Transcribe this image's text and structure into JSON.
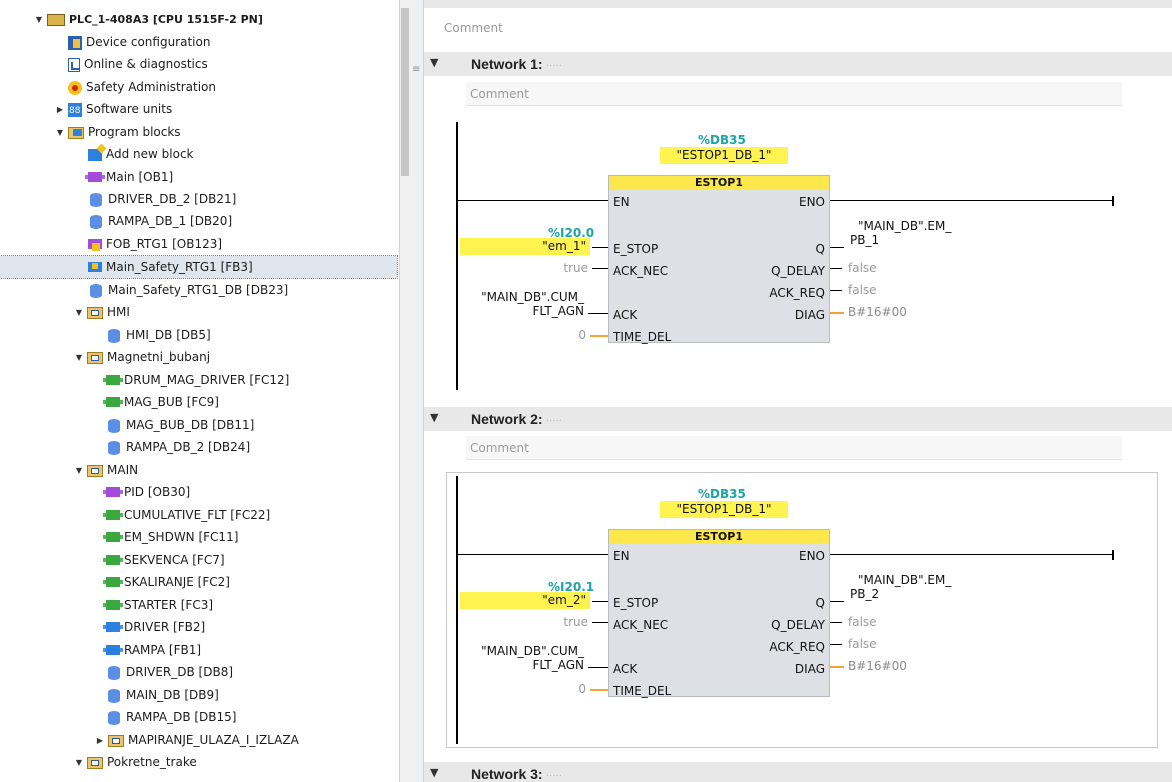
{
  "tree": {
    "items": [
      {
        "label": "PLC_1-408A3 [CPU 1515F-2 PN]",
        "icon": "plc-icon"
      },
      {
        "label": "Device configuration",
        "icon": "device-config-icon"
      },
      {
        "label": "Online & diagnostics",
        "icon": "online-diagnostics-icon"
      },
      {
        "label": "Safety Administration",
        "icon": "safety-admin-icon"
      },
      {
        "label": "Software units",
        "icon": "software-units-icon"
      },
      {
        "label": "Program blocks",
        "icon": "folder-icon"
      },
      {
        "label": "Add new block",
        "icon": "add-block-icon"
      },
      {
        "label": "Main [OB1]",
        "icon": "ob-icon"
      },
      {
        "label": "DRIVER_DB_2 [DB21]",
        "icon": "db-icon"
      },
      {
        "label": "RAMPA_DB_1 [DB20]",
        "icon": "db-icon"
      },
      {
        "label": "FOB_RTG1 [OB123]",
        "icon": "fob-icon"
      },
      {
        "label": "Main_Safety_RTG1 [FB3]",
        "icon": "safety-fb-icon"
      },
      {
        "label": "Main_Safety_RTG1_DB [DB23]",
        "icon": "db-icon"
      },
      {
        "label": "HMI",
        "icon": "group-folder-icon"
      },
      {
        "label": "HMI_DB [DB5]",
        "icon": "db-icon"
      },
      {
        "label": "Magnetni_bubanj",
        "icon": "group-folder-icon"
      },
      {
        "label": "DRUM_MAG_DRIVER [FC12]",
        "icon": "fc-icon"
      },
      {
        "label": "MAG_BUB [FC9]",
        "icon": "fc-icon"
      },
      {
        "label": "MAG_BUB_DB [DB11]",
        "icon": "db-icon"
      },
      {
        "label": "RAMPA_DB_2 [DB24]",
        "icon": "db-icon"
      },
      {
        "label": "MAIN",
        "icon": "group-folder-icon"
      },
      {
        "label": "PID [OB30]",
        "icon": "ob-icon"
      },
      {
        "label": "CUMULATIVE_FLT [FC22]",
        "icon": "fc-icon"
      },
      {
        "label": "EM_SHDWN [FC11]",
        "icon": "fc-icon"
      },
      {
        "label": "SEKVENCA [FC7]",
        "icon": "fc-icon"
      },
      {
        "label": "SKALIRANJE [FC2]",
        "icon": "fc-icon"
      },
      {
        "label": "STARTER [FC3]",
        "icon": "fc-icon"
      },
      {
        "label": "DRIVER [FB2]",
        "icon": "fb-icon"
      },
      {
        "label": "RAMPA [FB1]",
        "icon": "fb-icon"
      },
      {
        "label": "DRIVER_DB [DB8]",
        "icon": "db-icon"
      },
      {
        "label": "MAIN_DB [DB9]",
        "icon": "db-icon"
      },
      {
        "label": "RAMPA_DB [DB15]",
        "icon": "db-icon"
      },
      {
        "label": "MAPIRANJE_ULAZA_I_IZLAZA",
        "icon": "group-folder-icon"
      },
      {
        "label": "Pokretne_trake",
        "icon": "group-folder-icon"
      }
    ]
  },
  "editor": {
    "top_comment": "Comment",
    "networks": [
      {
        "title": "Network 1:",
        "title_comment": ".....",
        "comment": "Comment",
        "instance_addr": "%DB35",
        "instance_name": "\"ESTOP1_DB_1\"",
        "block_name": "ESTOP1",
        "pins_in": [
          "EN",
          "E_STOP",
          "ACK_NEC",
          "ACK",
          "TIME_DEL"
        ],
        "pins_out": [
          "ENO",
          "Q",
          "Q_DELAY",
          "ACK_REQ",
          "DIAG"
        ],
        "estop_addr": "%I20.0",
        "estop_var": "\"em_1\"",
        "ack_nec_val": "true",
        "ack_var_line1": "\"MAIN_DB\".CUM_",
        "ack_var_line2": "FLT_AGN",
        "time_del_val": "0",
        "q_var_line1": "\"MAIN_DB\".EM_",
        "q_var_line2": "PB_1",
        "q_delay_val": "false",
        "ack_req_val": "false",
        "diag_val": "B#16#00"
      },
      {
        "title": "Network 2:",
        "title_comment": ".....",
        "comment": "Comment",
        "instance_addr": "%DB35",
        "instance_name": "\"ESTOP1_DB_1\"",
        "block_name": "ESTOP1",
        "pins_in": [
          "EN",
          "E_STOP",
          "ACK_NEC",
          "ACK",
          "TIME_DEL"
        ],
        "pins_out": [
          "ENO",
          "Q",
          "Q_DELAY",
          "ACK_REQ",
          "DIAG"
        ],
        "estop_addr": "%I20.1",
        "estop_var": "\"em_2\"",
        "ack_nec_val": "true",
        "ack_var_line1": "\"MAIN_DB\".CUM_",
        "ack_var_line2": "FLT_AGN",
        "time_del_val": "0",
        "q_var_line1": "\"MAIN_DB\".EM_",
        "q_var_line2": "PB_2",
        "q_delay_val": "false",
        "ack_req_val": "false",
        "diag_val": "B#16#00"
      },
      {
        "title": "Network 3:",
        "title_comment": "....."
      }
    ]
  },
  "colors": {
    "variable_highlight": "#fff44f",
    "address_teal": "#1aa5a8",
    "block_header": "#fde84b",
    "block_body": "#dde1e6",
    "int_wire": "#f2a33a"
  }
}
